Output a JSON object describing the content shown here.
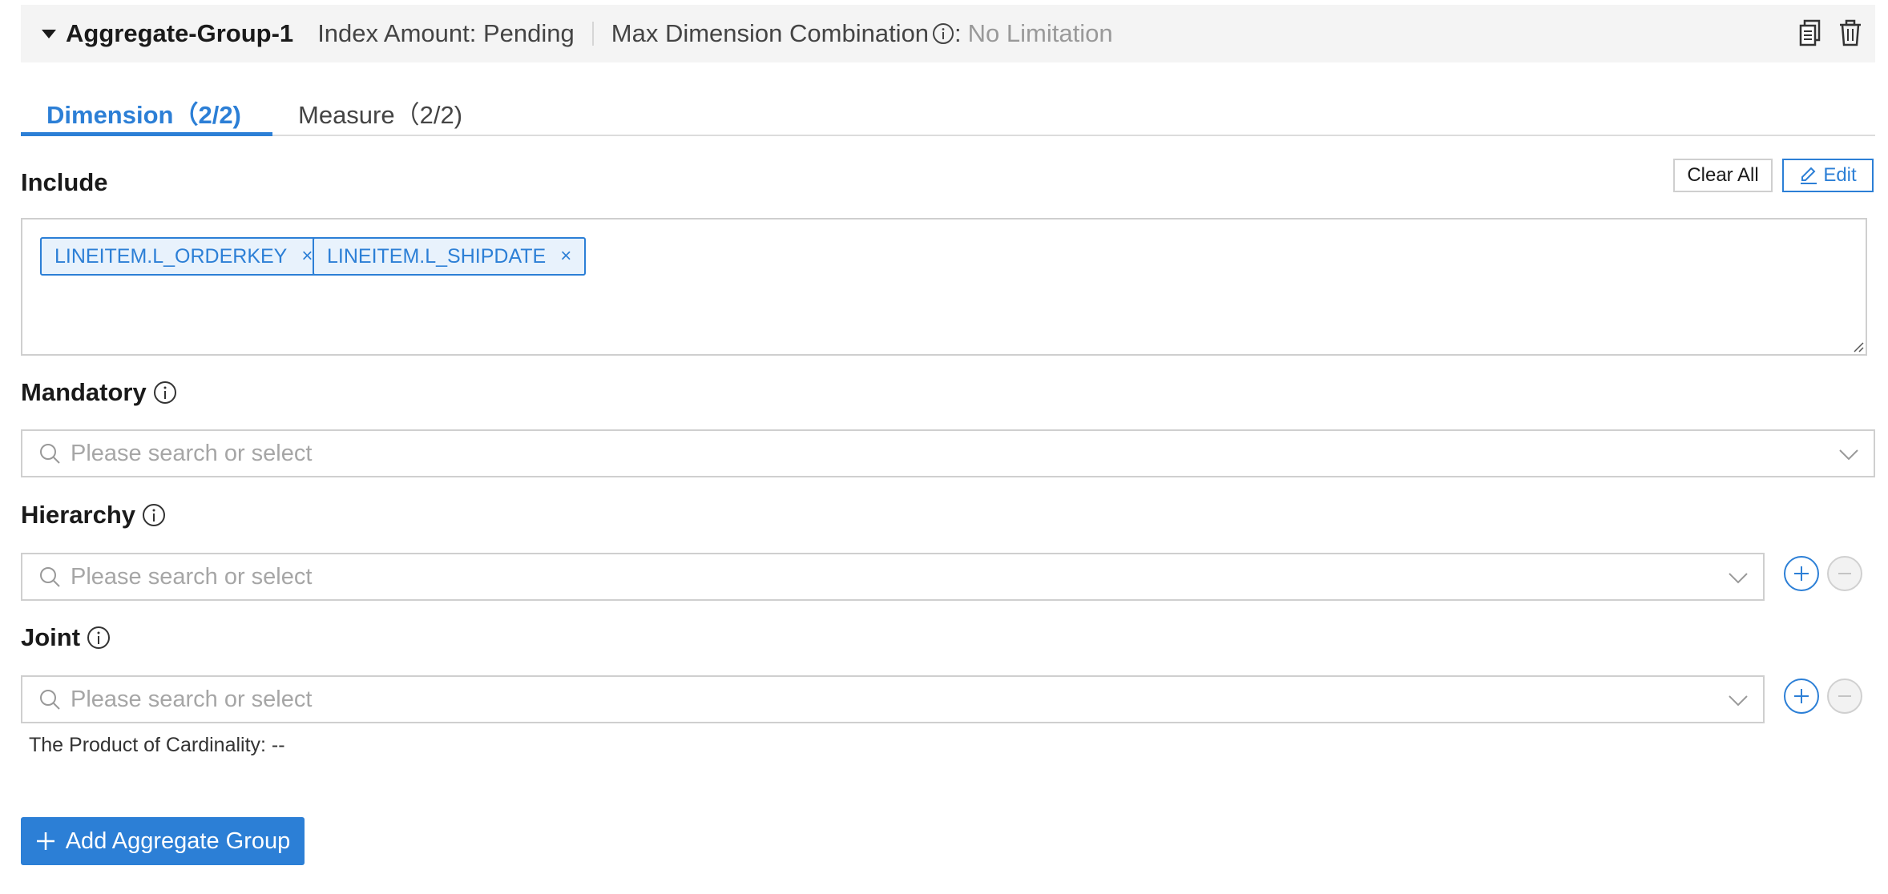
{
  "group_header": {
    "title": "Aggregate-Group-1",
    "index_amount": "Index Amount: Pending",
    "max_dim_label": "Max Dimension Combination",
    "max_dim_colon": ":",
    "max_dim_value": "No Limitation",
    "copy_icon": "copy-icon",
    "delete_icon": "trash-icon"
  },
  "tabs": [
    {
      "label": "Dimension（2/2)",
      "active": true
    },
    {
      "label": "Measure（2/2)",
      "active": false
    }
  ],
  "include": {
    "label": "Include",
    "clear_all": "Clear All",
    "edit": "Edit",
    "tags": [
      "LINEITEM.L_ORDERKEY",
      "LINEITEM.L_SHIPDATE"
    ],
    "tag_close": "×"
  },
  "mandatory": {
    "label": "Mandatory",
    "placeholder": "Please search or select"
  },
  "hierarchy": {
    "label": "Hierarchy",
    "placeholder": "Please search or select"
  },
  "joint": {
    "label": "Joint",
    "placeholder": "Please search or select"
  },
  "cardinality": "The Product of Cardinality: --",
  "add_group": "Add Aggregate Group",
  "colors": {
    "accent": "#2c7fd6",
    "header_bg": "#f4f4f4",
    "placeholder": "#a6a6a6"
  }
}
